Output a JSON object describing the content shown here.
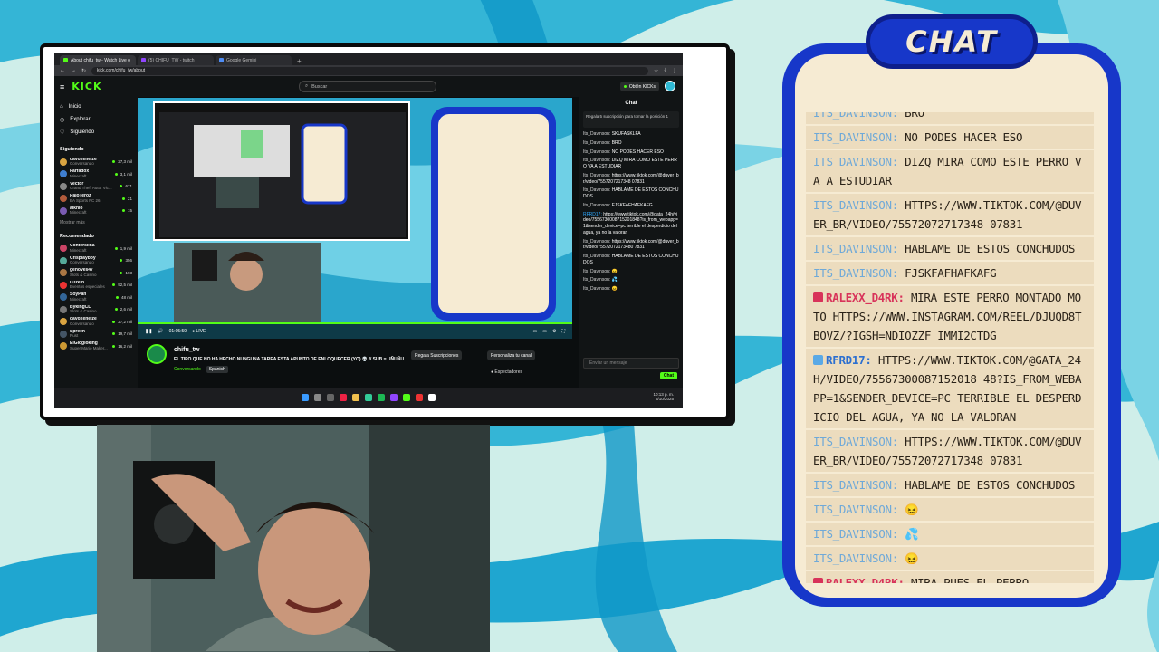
{
  "browser": {
    "tabs": [
      {
        "title": "About chifu_tw - Watch Live o",
        "active": true,
        "favicon_color": "#53fc18"
      },
      {
        "title": "(5) CHIFU_TW - twitch",
        "active": false,
        "favicon_color": "#9146ff"
      },
      {
        "title": "Google Gemini",
        "active": false,
        "favicon_color": "#4f8df5"
      }
    ],
    "url": "kick.com/chifu_tw/about"
  },
  "kick": {
    "logo": "KICK",
    "search_placeholder": "Buscar",
    "get_kicks": "Obtén KICKs",
    "nav": [
      "Inicio",
      "Explorar",
      "Siguiendo"
    ],
    "following_title": "Siguiendo",
    "following": [
      {
        "name": "davoxeneize",
        "game": "Conversando",
        "viewers": "27,3 mil",
        "color": "#d9a441"
      },
      {
        "name": "Farfadox",
        "game": "Minecraft",
        "viewers": "3,1 mil",
        "color": "#3f7fd1"
      },
      {
        "name": "Vector",
        "game": "Grand Theft Auto: Vic...",
        "viewers": "671",
        "color": "#888888"
      },
      {
        "name": "PaioTeroz",
        "game": "EA Sports FC 26",
        "viewers": "21",
        "color": "#b25b3b"
      },
      {
        "name": "aiknio",
        "game": "Minecraft",
        "viewers": "15",
        "color": "#7a5bb2"
      }
    ],
    "show_more": "Mostrar más",
    "recommended_title": "Recomendado",
    "recommended": [
      {
        "name": "Contersiina",
        "game": "Minecraft",
        "viewers": "1,9 mil",
        "color": "#c46"
      },
      {
        "name": "Crisplayboy",
        "game": "Conversando",
        "viewers": "356",
        "color": "#5a9"
      },
      {
        "name": "genoves47",
        "game": "Slots & Casino",
        "viewers": "193",
        "color": "#a74"
      },
      {
        "name": "D3zein",
        "game": "Eventos especiales",
        "viewers": "92,5 mil",
        "color": "#e33"
      },
      {
        "name": "SoyPan",
        "game": "Minecraft",
        "viewers": "48 mil",
        "color": "#369"
      },
      {
        "name": "BykingCL",
        "game": "Slots & Casino",
        "viewers": "2,6 mil",
        "color": "#777"
      },
      {
        "name": "davoxeneize",
        "game": "Conversando",
        "viewers": "27,2 mil",
        "color": "#d9a441"
      },
      {
        "name": "Spreen",
        "game": "Rust",
        "viewers": "19,7 mil",
        "color": "#456"
      },
      {
        "name": "ElGlogloking",
        "game": "Super Mario Maker...",
        "viewers": "16,2 mil",
        "color": "#c93"
      }
    ],
    "player": {
      "time": "01:05:59",
      "live": "LIVE"
    },
    "stream": {
      "channel": "chifu_tw",
      "title": "EL TIPO QUE NO HA HECHO NUNGUNA TAREA ESTA APUNTO DE ENLOQUECER (YO) 💀 // SUB = UÑUÑU",
      "category": "Conversando",
      "language": "Spanish",
      "gift_button": "Regala Suscripciones",
      "customize_button": "Personaliza tu canal",
      "viewers_label": "Espectadores"
    },
    "chat": {
      "header": "Chat",
      "pinned": "Regala 5 suscripción para tomar la posición 1",
      "messages": [
        {
          "user": "Its_Davinson:",
          "text": "SKUFASKLFA",
          "c": "u"
        },
        {
          "user": "Its_Davinson:",
          "text": "BRO",
          "c": "u"
        },
        {
          "user": "Its_Davinson:",
          "text": "NO PODES HACER ESO",
          "c": "u"
        },
        {
          "user": "Its_Davinson:",
          "text": "DIZQ MIRA COMO ESTE PERRO VA A ESTUDIAR",
          "c": "u"
        },
        {
          "user": "Its_Davinson:",
          "text": "https://www.tiktok.com/@duver_br/video/7557207217348 07831",
          "c": "u"
        },
        {
          "user": "Its_Davinson:",
          "text": "HABLAME DE ESTOS CONCHUDOS",
          "c": "u"
        },
        {
          "user": "Its_Davinson:",
          "text": "FJSKFAFHAFKAFG",
          "c": "u"
        },
        {
          "user": "RFRD17:",
          "text": "https://www.tiktok.com/@gata_24h/video/7556730008715201848?is_from_webapp=1&sender_device=pc terrible el desperdicio del agua, ya no la valoran",
          "c": "u2"
        },
        {
          "user": "Its_Davinson:",
          "text": "https://www.tiktok.com/@duver_br/video/75572072173480 7831",
          "c": "u"
        },
        {
          "user": "Its_Davinson:",
          "text": "HABLAME DE ESTOS CONCHUDOS",
          "c": "u"
        },
        {
          "user": "Its_Davinson:",
          "text": "😖",
          "c": "u"
        },
        {
          "user": "Its_Davinson:",
          "text": "💦",
          "c": "u"
        },
        {
          "user": "Its_Davinson:",
          "text": "😖",
          "c": "u"
        }
      ],
      "input_placeholder": "Enviar un mensaje",
      "send_button": "Chat"
    },
    "clock": {
      "time": "10:13 p. m.",
      "date": "6/10/2025",
      "lang": "ESP LAA"
    }
  },
  "overlay_chat": {
    "title": "CHAT",
    "messages": [
      {
        "user": "ITS_DAVINSON:",
        "text": "BRO",
        "style": "plain"
      },
      {
        "user": "ITS_DAVINSON:",
        "text": "NO PODES HACER ESO",
        "style": "plain"
      },
      {
        "user": "ITS_DAVINSON:",
        "text": "DIZQ MIRA COMO ESTE PERRO VA A ESTUDIAR",
        "style": "plain"
      },
      {
        "user": "ITS_DAVINSON:",
        "text": "HTTPS://WWW.TIKTOK.COM/@DUVER_BR/VIDEO/75572072717348 07831",
        "style": "plain"
      },
      {
        "user": "ITS_DAVINSON:",
        "text": "HABLAME DE ESTOS CONCHUDOS",
        "style": "plain"
      },
      {
        "user": "ITS_DAVINSON:",
        "text": "FJSKFAFHAFKAFG",
        "style": "plain"
      },
      {
        "user": "RALEXX_D4RK:",
        "text": "MIRA ESTE PERRO MONTADO MOTO HTTPS://WWW.INSTAGRAM.COM/REEL/DJUQD8TBOVZ/?IGSH=NDIOZZF IMMI2CTDG",
        "style": "pink"
      },
      {
        "user": "RFRD17:",
        "text": "HTTPS://WWW.TIKTOK.COM/@GATA_24H/VIDEO/75567300087152018 48?IS_FROM_WEBAPP=1&SENDER_DEVICE=PC TERRIBLE EL DESPERDICIO DEL AGUA, YA NO LA VALORAN",
        "style": "blue"
      },
      {
        "user": "ITS_DAVINSON:",
        "text": "HTTPS://WWW.TIKTOK.COM/@DUVER_BR/VIDEO/75572072717348 07831",
        "style": "plain"
      },
      {
        "user": "ITS_DAVINSON:",
        "text": "HABLAME DE ESTOS CONCHUDOS",
        "style": "plain"
      },
      {
        "user": "ITS_DAVINSON:",
        "text": "😖",
        "style": "plain"
      },
      {
        "user": "ITS_DAVINSON:",
        "text": "💦",
        "style": "plain"
      },
      {
        "user": "ITS_DAVINSON:",
        "text": "😖",
        "style": "plain"
      },
      {
        "user": "RALEXX_D4RK:",
        "text": "MIRA PUES EL PERRO",
        "style": "pink"
      }
    ]
  },
  "colors": {
    "kick_green": "#53fc18",
    "chat_blue": "#1737c9",
    "chat_cream": "#f6ebd3",
    "bg_teal": "#2fb9d4"
  }
}
